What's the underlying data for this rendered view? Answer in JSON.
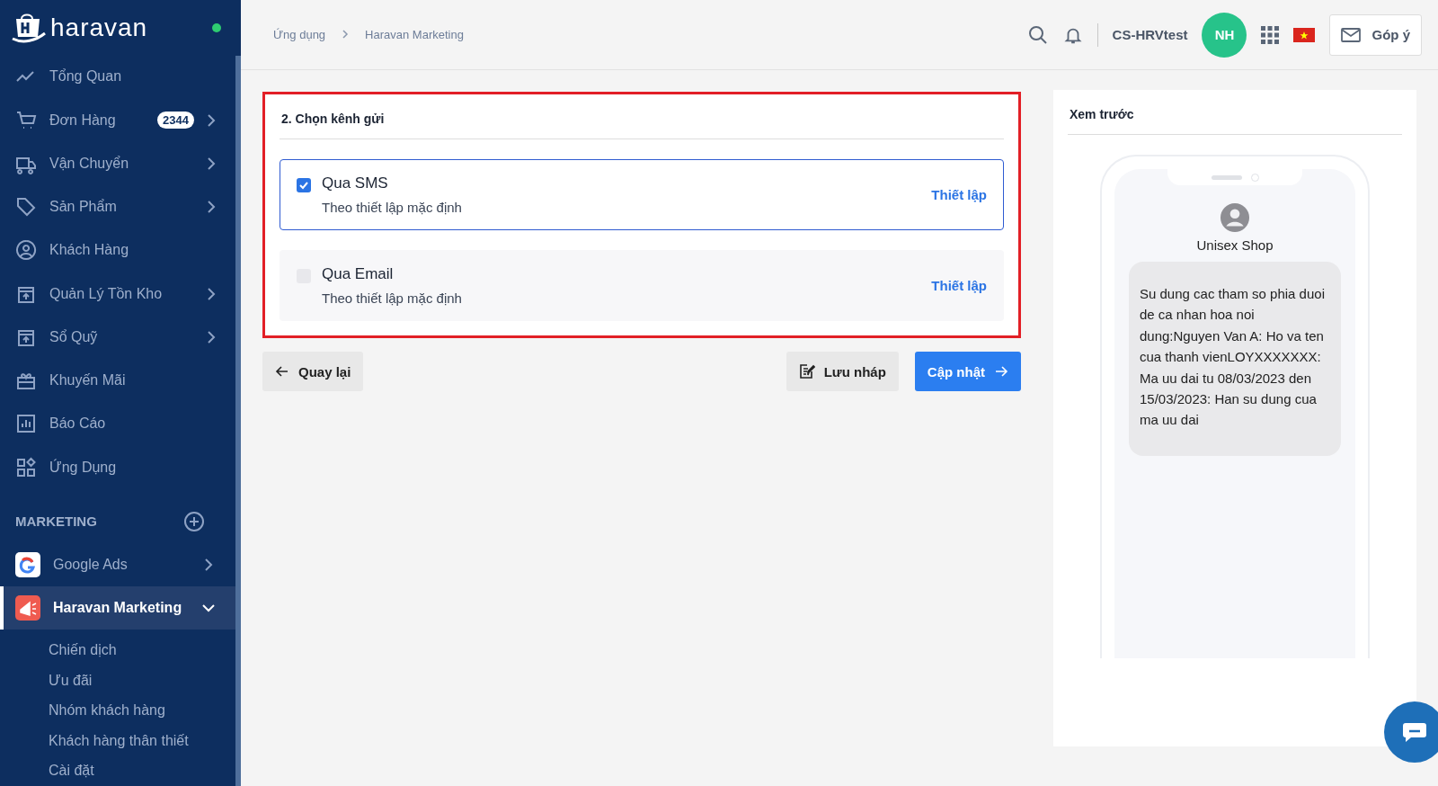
{
  "sidebar": {
    "logo": "haravan",
    "online": true,
    "items": [
      {
        "label": "Tổng Quan",
        "submenu": false
      },
      {
        "label": "Đơn Hàng",
        "badge": "2344",
        "submenu": true
      },
      {
        "label": "Vận Chuyển",
        "submenu": true
      },
      {
        "label": "Sản Phẩm",
        "submenu": true
      },
      {
        "label": "Khách Hàng",
        "submenu": false
      },
      {
        "label": "Quản Lý Tồn Kho",
        "submenu": true
      },
      {
        "label": "Sổ Quỹ",
        "submenu": true
      },
      {
        "label": "Khuyến Mãi",
        "submenu": false
      },
      {
        "label": "Báo Cáo",
        "submenu": false
      },
      {
        "label": "Ứng Dụng",
        "submenu": false
      }
    ],
    "section": "MARKETING",
    "apps": [
      {
        "label": "Google Ads",
        "selected": false,
        "expanded": false
      },
      {
        "label": "Haravan Marketing",
        "selected": true,
        "expanded": true
      }
    ],
    "subitems": [
      "Chiến dịch",
      "Ưu đãi",
      "Nhóm khách hàng",
      "Khách hàng thân thiết",
      "Cài đặt"
    ]
  },
  "breadcrumb": [
    "Ứng dụng",
    "Haravan Marketing"
  ],
  "header": {
    "store": "CS-HRVtest",
    "avatar": "NH",
    "feedback": "Góp ý"
  },
  "channel_card": {
    "title": "2. Chọn kênh gửi",
    "channels": [
      {
        "name": "Qua SMS",
        "note": "Theo thiết lập mặc định",
        "checked": true,
        "action": "Thiết lập"
      },
      {
        "name": "Qua Email",
        "note": "Theo thiết lập mặc định",
        "checked": false,
        "action": "Thiết lập"
      }
    ]
  },
  "buttons": {
    "back": "Quay lại",
    "draft": "Lưu nháp",
    "update": "Cập nhật"
  },
  "preview": {
    "title": "Xem trước",
    "sender": "Unisex Shop",
    "message": "Su dung cac tham so phia duoi de ca nhan hoa noi dung:Nguyen Van A: Ho va ten cua thanh vienLOYXXXXXXX: Ma uu dai tu 08/03/2023 den 15/03/2023: Han su dung cua ma uu dai"
  }
}
